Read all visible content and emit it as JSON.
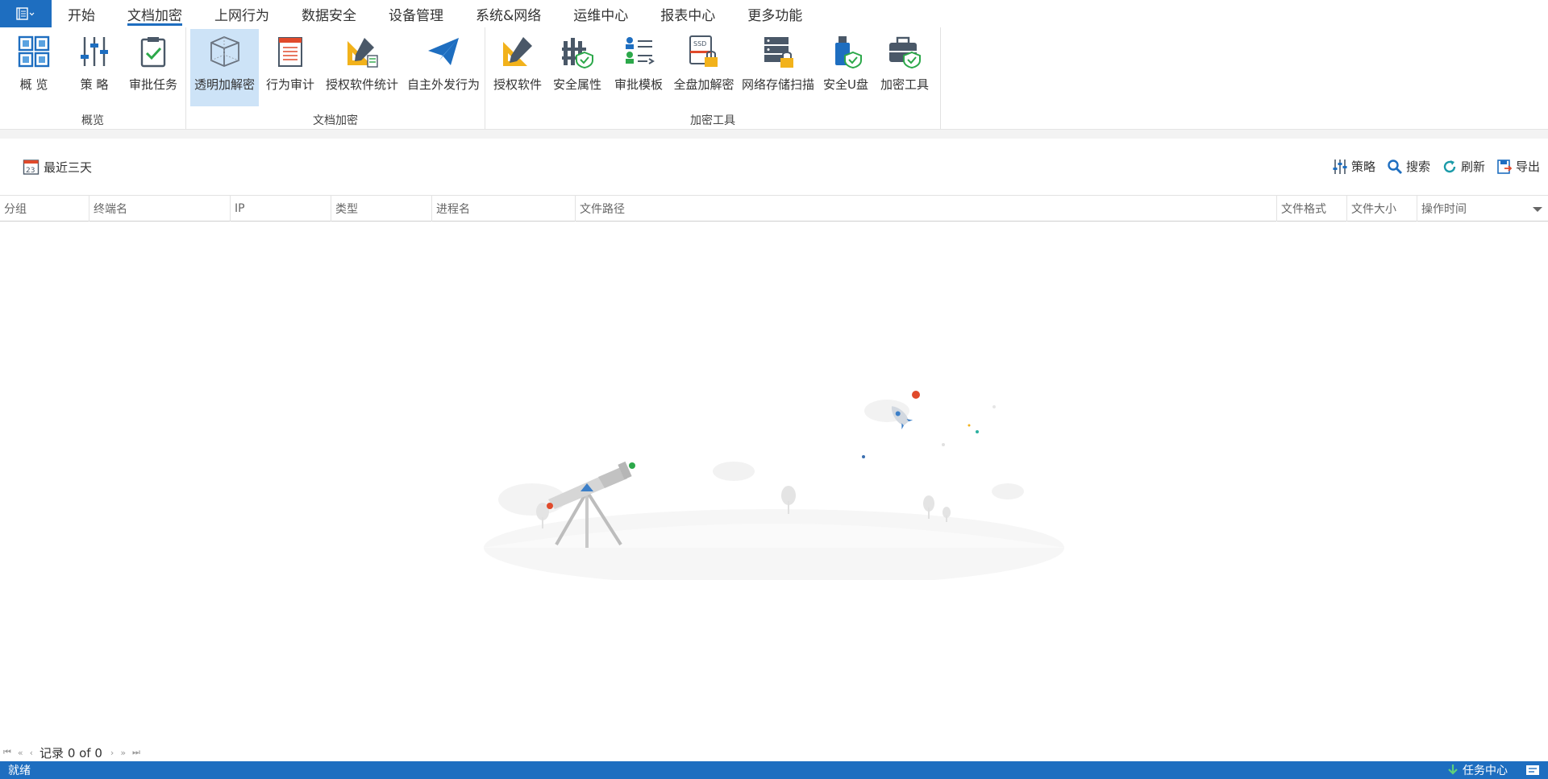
{
  "menu": {
    "items": [
      "开始",
      "文档加密",
      "上网行为",
      "数据安全",
      "设备管理",
      "系统&网络",
      "运维中心",
      "报表中心",
      "更多功能"
    ],
    "active_index": 1
  },
  "ribbon": {
    "groups": [
      {
        "label": "概览",
        "buttons": [
          {
            "label": "概 览",
            "icon": "grid-icon"
          },
          {
            "label": "策 略",
            "icon": "sliders-icon"
          },
          {
            "label": "审批任务",
            "icon": "clipboard-check-icon"
          }
        ]
      },
      {
        "label": "文档加密",
        "buttons": [
          {
            "label": "透明加解密",
            "icon": "cube-icon",
            "selected": true
          },
          {
            "label": "行为审计",
            "icon": "document-list-icon"
          },
          {
            "label": "授权软件统计",
            "icon": "ruler-pencil-chart-icon"
          },
          {
            "label": "自主外发行为",
            "icon": "paper-plane-icon"
          }
        ]
      },
      {
        "label": "加密工具",
        "buttons": [
          {
            "label": "授权软件",
            "icon": "ruler-pencil-icon"
          },
          {
            "label": "安全属性",
            "icon": "fence-shield-icon"
          },
          {
            "label": "审批模板",
            "icon": "users-list-icon"
          },
          {
            "label": "全盘加解密",
            "icon": "ssd-lock-icon"
          },
          {
            "label": "网络存储扫描",
            "icon": "server-lock-icon"
          },
          {
            "label": "安全U盘",
            "icon": "usb-shield-icon"
          },
          {
            "label": "加密工具",
            "icon": "toolbox-shield-icon"
          }
        ]
      }
    ]
  },
  "toolbar": {
    "date_range": "最近三天",
    "calendar_day": "23",
    "policy": "策略",
    "search": "搜索",
    "refresh": "刷新",
    "export": "导出"
  },
  "table": {
    "columns": [
      "分组",
      "终端名",
      "IP",
      "类型",
      "进程名",
      "文件路径",
      "文件格式",
      "文件大小",
      "操作时间"
    ]
  },
  "pager": {
    "records": "记录 0 of 0"
  },
  "status": {
    "text": "就绪",
    "task_center": "任务中心"
  },
  "colors": {
    "accent": "#1e6ec0",
    "selected_bg": "#cde3f7"
  }
}
